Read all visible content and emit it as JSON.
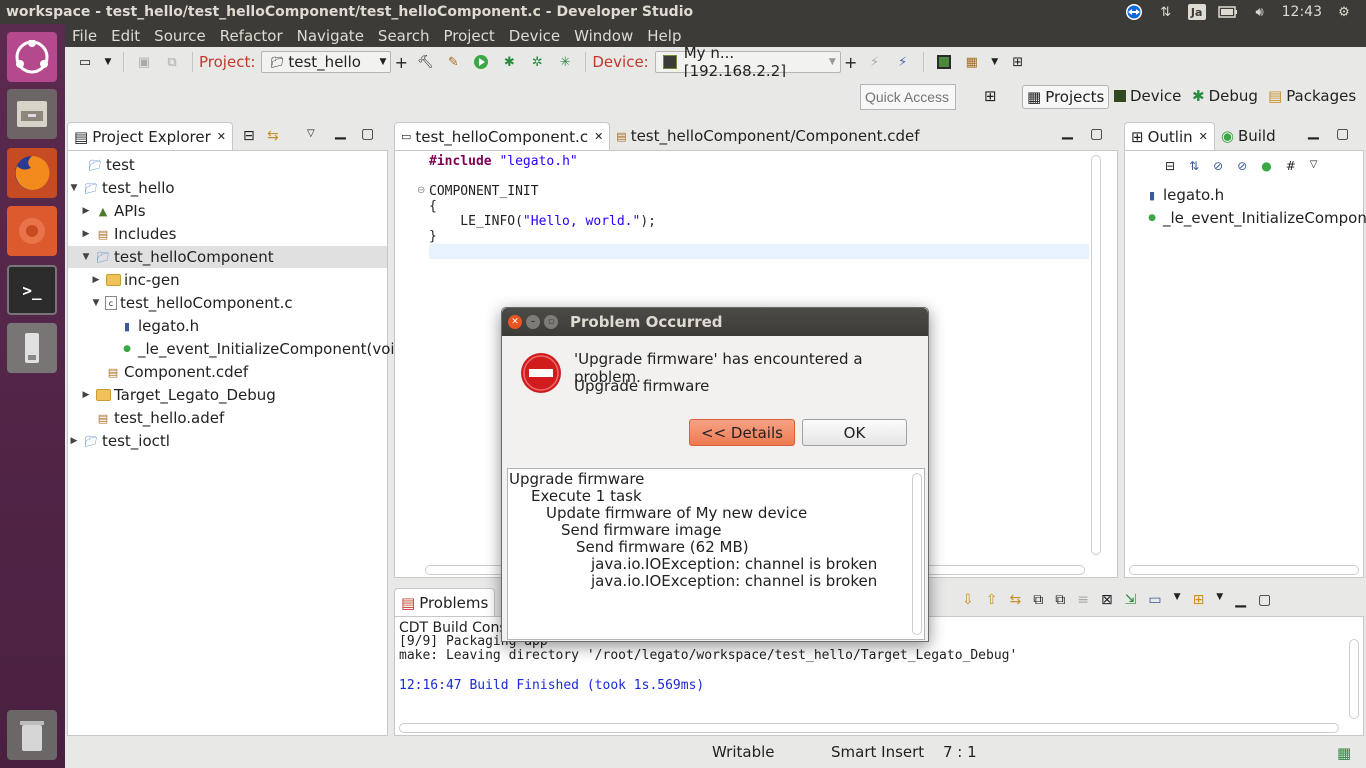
{
  "window_title": "workspace - test_hello/test_helloComponent/test_helloComponent.c - Developer Studio",
  "tray": {
    "lang": "Ja",
    "time": "12:43"
  },
  "menu": [
    "File",
    "Edit",
    "Source",
    "Refactor",
    "Navigate",
    "Search",
    "Project",
    "Device",
    "Window",
    "Help"
  ],
  "toolbar": {
    "project_label": "Project:",
    "project_value": "test_hello",
    "device_label": "Device:",
    "device_value": "My n... [192.168.2.2]"
  },
  "quick_access_placeholder": "Quick Access",
  "perspectives": [
    "Projects",
    "Device",
    "Debug",
    "Packages"
  ],
  "explorer": {
    "tab": "Project Explorer",
    "rows": [
      "test",
      "test_hello",
      "APIs",
      "Includes",
      "test_helloComponent",
      "inc-gen",
      "test_helloComponent.c",
      "legato.h",
      "_le_event_InitializeComponent(void)",
      "Component.cdef",
      "Target_Legato_Debug",
      "test_hello.adef",
      "test_ioctl"
    ]
  },
  "editor": {
    "tabs": [
      "test_helloComponent.c",
      "test_helloComponent/Component.cdef"
    ],
    "lines": {
      "l1_kw": "#include",
      "l1_str": " \"legato.h\"",
      "l3": "COMPONENT_INIT",
      "l4": "{",
      "l5_a": "    LE_INFO(",
      "l5_str": "\"Hello, world.\"",
      "l5_b": ");",
      "l6": "}"
    }
  },
  "outline": {
    "tabs": [
      "Outlin",
      "Build"
    ],
    "items": [
      "legato.h",
      "_le_event_InitializeComponen"
    ]
  },
  "console": {
    "tab": "Problems",
    "subtitle": "CDT Build Cons",
    "lines": [
      "[9/9] Packaging app",
      "make: Leaving directory '/root/legato/workspace/test_hello/Target_Legato_Debug'",
      "12:16:47 Build Finished (took 1s.569ms)"
    ]
  },
  "dialog": {
    "title": "Problem Occurred",
    "message": "'Upgrade firmware' has encountered a problem.",
    "sub": "Upgrade firmware",
    "details_button": "<< Details",
    "ok_button": "OK",
    "details": [
      "Upgrade firmware",
      "Execute 1 task",
      "Update firmware of My new device",
      "Send firmware image",
      "Send firmware (62 MB)",
      "java.io.IOException: channel is broken",
      "java.io.IOException: channel is broken"
    ]
  },
  "status": {
    "mode": "Writable",
    "insert": "Smart Insert",
    "pos": "7 : 1"
  },
  "colors": {
    "launcher": "#5b2a4f",
    "accent_orange": "#f0825a",
    "error_red": "#d01c1c",
    "string_blue": "#2a00ff",
    "keyword": "#7f0055"
  }
}
